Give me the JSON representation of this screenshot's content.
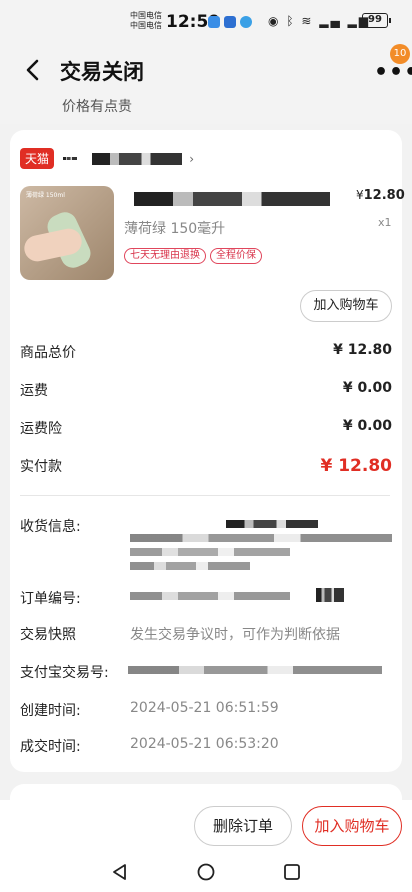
{
  "status_bar": {
    "carrier_line1": "中国电信",
    "carrier_line2": "中国电信",
    "time": "12:59",
    "battery": "99"
  },
  "header": {
    "title": "交易关闭",
    "subtitle": "价格有点贵",
    "notification_count": "10"
  },
  "shop": {
    "platform_label": "天猫"
  },
  "product": {
    "thumb_tag": "薄荷绿 150ml",
    "currency": "¥",
    "price": "12.80",
    "quantity": "x1",
    "spec": "薄荷绿  150毫升",
    "tags": [
      "七天无理由退换",
      "全程价保"
    ],
    "add_to_cart_label": "加入购物车"
  },
  "summary": {
    "goods_total_label": "商品总价",
    "goods_total_value": "¥ 12.80",
    "shipping_label": "运费",
    "shipping_value": "¥ 0.00",
    "shipping_insurance_label": "运费险",
    "shipping_insurance_value": "¥ 0.00",
    "paid_label": "实付款",
    "paid_value": "¥ 12.80"
  },
  "details": {
    "receiver_label": "收货信息:",
    "order_no_label": "订单编号:",
    "snapshot_label": "交易快照",
    "snapshot_value": "发生交易争议时，可作为判断依据",
    "alipay_label": "支付宝交易号:",
    "created_label": "创建时间:",
    "created_value": "2024-05-21 06:51:59",
    "completed_label": "成交时间:",
    "completed_value": "2024-05-21 06:53:20"
  },
  "actions": {
    "delete_order": "删除订单",
    "add_to_cart": "加入购物车"
  },
  "colors": {
    "accent_red": "#e02e24",
    "badge_orange": "#f28c28"
  }
}
